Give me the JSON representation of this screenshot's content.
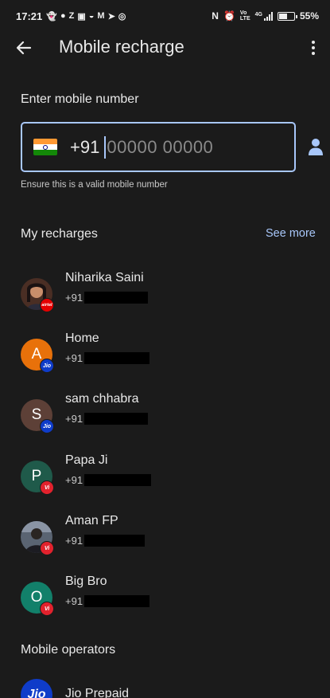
{
  "status_bar": {
    "time": "17:21",
    "icons": [
      "snapchat-icon",
      "location-icon",
      "zomato-icon",
      "gallery-icon",
      "cloud-icon",
      "gmail-icon",
      "telegram-icon",
      "whatsapp-icon"
    ],
    "network_label": "4G",
    "battery_percent": "55%",
    "battery_level": 0.55
  },
  "app_bar": {
    "title": "Mobile recharge"
  },
  "number_entry": {
    "label": "Enter mobile number",
    "country_code": "+91",
    "placeholder": "00000 00000",
    "value": "",
    "helper": "Ensure this is a valid mobile number"
  },
  "recharges": {
    "heading": "My recharges",
    "see_more": "See more",
    "items": [
      {
        "name": "Niharika Saini",
        "prefix": "+91",
        "initial": "",
        "avatar_color": "#5a3a2e",
        "operator": "airtel",
        "badge_text": "airtel",
        "badge_color": "#e40000"
      },
      {
        "name": "Home",
        "prefix": "+91",
        "initial": "A",
        "avatar_color": "#e8710a",
        "operator": "jio",
        "badge_text": "Jio",
        "badge_color": "#0f3cc9"
      },
      {
        "name": "sam chhabra",
        "prefix": "+91",
        "initial": "S",
        "avatar_color": "#5d4037",
        "operator": "jio",
        "badge_text": "Jio",
        "badge_color": "#0f3cc9"
      },
      {
        "name": "Papa Ji",
        "prefix": "+91",
        "initial": "P",
        "avatar_color": "#1f5a4a",
        "operator": "vi",
        "badge_text": "Vi",
        "badge_color": "#e2222d"
      },
      {
        "name": "Aman FP",
        "prefix": "+91",
        "initial": "",
        "avatar_color": "#3a4150",
        "operator": "vi",
        "badge_text": "Vi",
        "badge_color": "#e2222d"
      },
      {
        "name": "Big Bro",
        "prefix": "+91",
        "initial": "O",
        "avatar_color": "#12806a",
        "operator": "vi",
        "badge_text": "Vi",
        "badge_color": "#e2222d"
      }
    ]
  },
  "operators": {
    "heading": "Mobile operators",
    "items": [
      {
        "name": "Jio Prepaid",
        "logo_text": "Jio",
        "logo_color": "#0f3cc9"
      }
    ]
  },
  "colors": {
    "background": "#1b1b1b",
    "accent": "#a8c7fa",
    "text_primary": "#e8e8e8",
    "text_secondary": "#c9c9c9"
  }
}
